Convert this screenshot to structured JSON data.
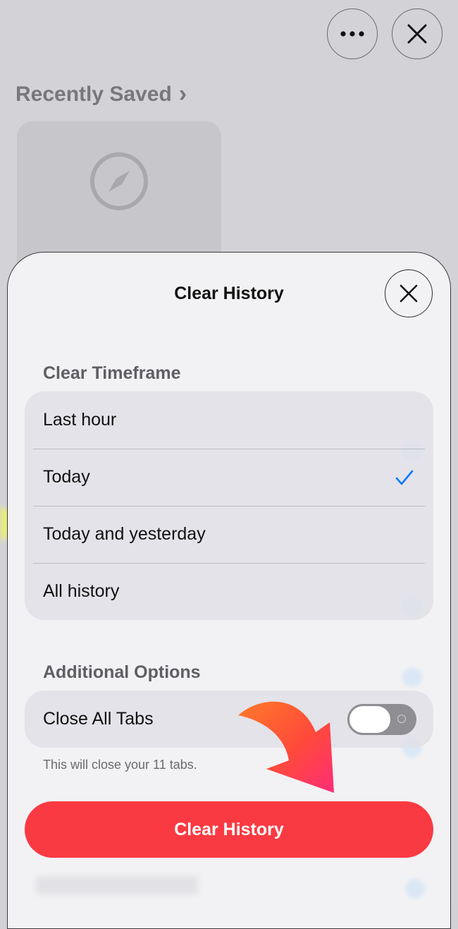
{
  "background": {
    "recently_saved_label": "Recently Saved",
    "recently_saved_chevron": "›"
  },
  "sheet": {
    "title": "Clear History",
    "timeframe_section_label": "Clear Timeframe",
    "timeframe_options": [
      {
        "label": "Last hour",
        "selected": false
      },
      {
        "label": "Today",
        "selected": true
      },
      {
        "label": "Today and yesterday",
        "selected": false
      },
      {
        "label": "All history",
        "selected": false
      }
    ],
    "selected_check": "✓",
    "additional_section_label": "Additional Options",
    "close_tabs_label": "Close All Tabs",
    "close_tabs_enabled": false,
    "close_tabs_note": "This will close your 11 tabs.",
    "clear_button_label": "Clear History"
  },
  "colors": {
    "accent_blue": "#0a7aff",
    "destructive_red": "#fa3a42",
    "annotation_arrow": "#ff4a3a"
  },
  "icons": {
    "more": "ellipsis-icon",
    "close": "close-icon",
    "compass": "compass-icon",
    "check": "checkmark-icon",
    "annotation": "annotation-arrow-icon"
  }
}
